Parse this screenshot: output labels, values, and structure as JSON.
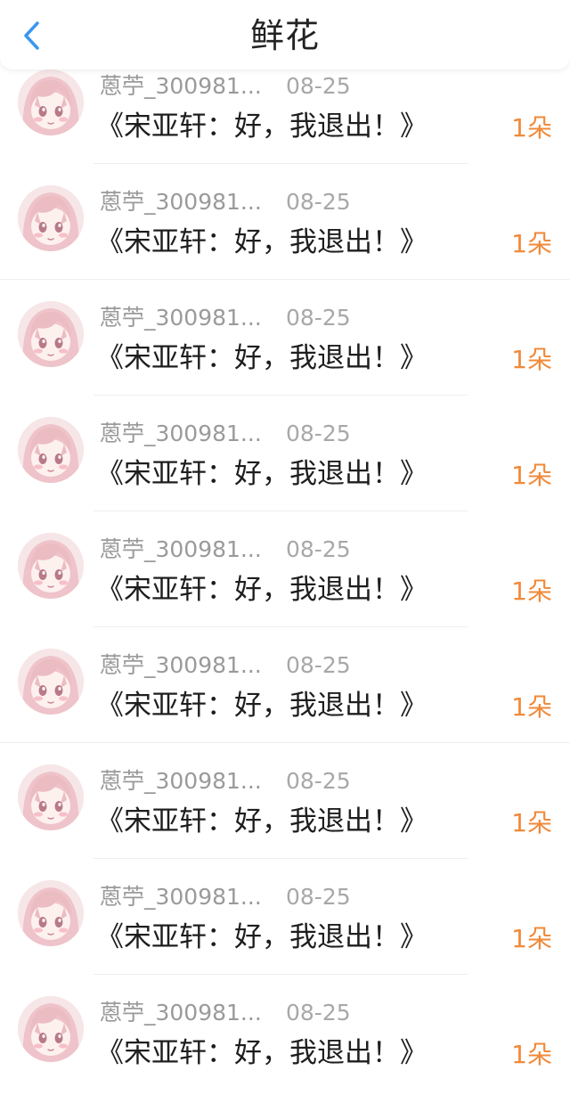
{
  "header": {
    "title": "鲜花"
  },
  "colors": {
    "accent_blue": "#3a97f1",
    "count_orange": "#f08a3a",
    "meta_gray": "#9a9a9a",
    "title_text": "#1e1e1e"
  },
  "items": [
    {
      "user": "蒽苧_300981...",
      "date": "08-25",
      "book": "《宋亚轩：好，我退出！》",
      "count": "1朵"
    },
    {
      "user": "蒽苧_300981...",
      "date": "08-25",
      "book": "《宋亚轩：好，我退出！》",
      "count": "1朵"
    },
    {
      "user": "蒽苧_300981...",
      "date": "08-25",
      "book": "《宋亚轩：好，我退出！》",
      "count": "1朵"
    },
    {
      "user": "蒽苧_300981...",
      "date": "08-25",
      "book": "《宋亚轩：好，我退出！》",
      "count": "1朵"
    },
    {
      "user": "蒽苧_300981...",
      "date": "08-25",
      "book": "《宋亚轩：好，我退出！》",
      "count": "1朵"
    },
    {
      "user": "蒽苧_300981...",
      "date": "08-25",
      "book": "《宋亚轩：好，我退出！》",
      "count": "1朵"
    },
    {
      "user": "蒽苧_300981...",
      "date": "08-25",
      "book": "《宋亚轩：好，我退出！》",
      "count": "1朵"
    },
    {
      "user": "蒽苧_300981...",
      "date": "08-25",
      "book": "《宋亚轩：好，我退出！》",
      "count": "1朵"
    },
    {
      "user": "蒽苧_300981...",
      "date": "08-25",
      "book": "《宋亚轩：好，我退出！》",
      "count": "1朵"
    }
  ]
}
